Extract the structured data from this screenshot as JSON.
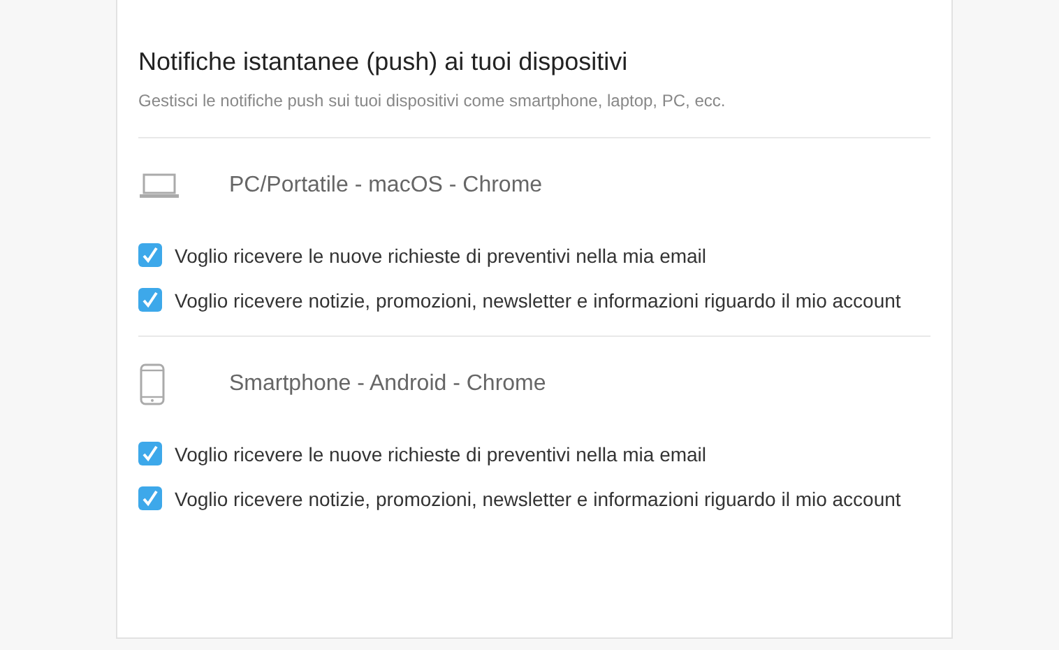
{
  "section": {
    "title": "Notifiche istantanee (push) ai tuoi dispositivi",
    "subtitle": "Gestisci le notifiche push sui tuoi dispositivi come smartphone, laptop, PC, ecc."
  },
  "devices": [
    {
      "kind": "laptop",
      "name": "PC/Portatile - macOS - Chrome",
      "options": [
        {
          "label": "Voglio ricevere le nuove richieste di preventivi nella mia email",
          "checked": true
        },
        {
          "label": "Voglio ricevere notizie, promozioni, newsletter e informazioni riguardo il mio account",
          "checked": true
        }
      ]
    },
    {
      "kind": "phone",
      "name": "Smartphone - Android - Chrome",
      "options": [
        {
          "label": "Voglio ricevere le nuove richieste di preventivi nella mia email",
          "checked": true
        },
        {
          "label": "Voglio ricevere notizie, promozioni, newsletter e informazioni riguardo il mio account",
          "checked": true
        }
      ]
    }
  ]
}
